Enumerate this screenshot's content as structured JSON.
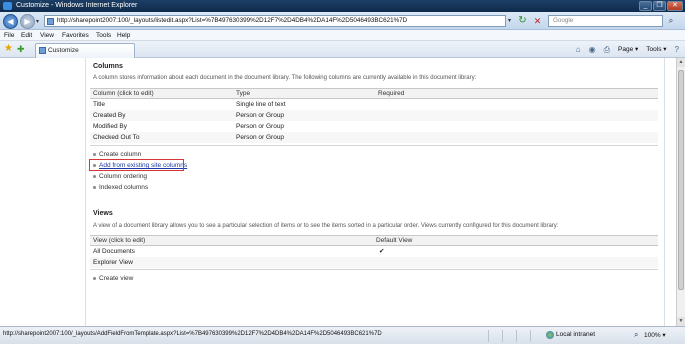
{
  "window": {
    "title": "Customize - Windows Internet Explorer",
    "minimize": "_",
    "restore": "❐",
    "close": "✕"
  },
  "address": {
    "url": "http://sharepoint2007:100/_layouts/listedit.aspx?List=%7B497630399%2D12F7%2D4DB4%2DA14F%2D5046493BC621%7D",
    "search_placeholder": "Google"
  },
  "menu": [
    "File",
    "Edit",
    "View",
    "Favorites",
    "Tools",
    "Help"
  ],
  "tab": {
    "label": "Customize"
  },
  "command_bar": {
    "page": "Page",
    "tools": "Tools"
  },
  "columns": {
    "title": "Columns",
    "description": "A column stores information about each document in the document library. The following columns are currently available in this document library:",
    "headers": [
      "Column (click to edit)",
      "Type",
      "Required"
    ],
    "rows": [
      [
        "Title",
        "Single line of text",
        ""
      ],
      [
        "Created By",
        "Person or Group",
        ""
      ],
      [
        "Modified By",
        "Person or Group",
        ""
      ],
      [
        "Checked Out To",
        "Person or Group",
        ""
      ]
    ],
    "links": [
      "Create column",
      "Add from existing site columns",
      "Column ordering",
      "Indexed columns"
    ]
  },
  "views": {
    "title": "Views",
    "description": "A view of a document library allows you to see a particular selection of items or to see the items sorted in a particular order. Views currently configured for this document library:",
    "headers": [
      "View (click to edit)",
      "Default View"
    ],
    "rows": [
      [
        "All Documents",
        "✔"
      ],
      [
        "Explorer View",
        ""
      ]
    ],
    "links": [
      "Create view"
    ]
  },
  "status": {
    "text": "http://sharepoint2007:100/_layouts/AddFieldFromTemplate.aspx?List=%7B497630399%2D12F7%2D4DB4%2DA14F%2D5046493BC621%7D",
    "zone": "Local intranet",
    "zoom": "100%"
  }
}
